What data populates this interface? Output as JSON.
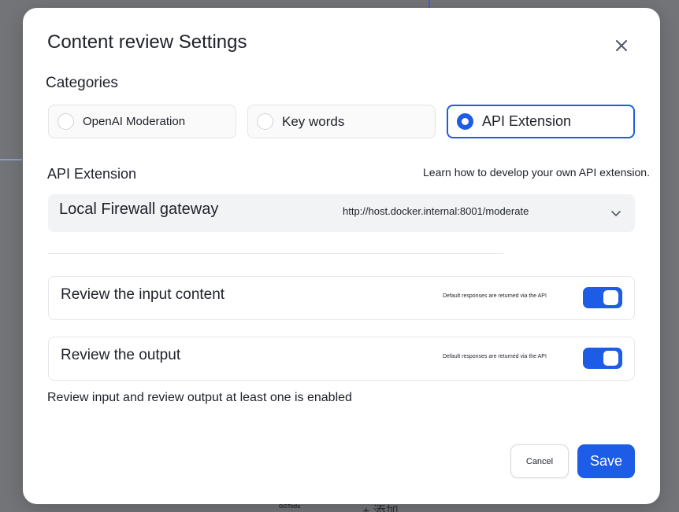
{
  "background": {
    "small_text": "GGToda",
    "add_text": "+ 添加"
  },
  "modal": {
    "title": "Content review Settings",
    "categories_label": "Categories",
    "categories": [
      {
        "label": "OpenAI Moderation",
        "selected": false
      },
      {
        "label": "Key words",
        "selected": false
      },
      {
        "label": "API Extension",
        "selected": true
      }
    ],
    "api_extension": {
      "label": "API Extension",
      "learn_link": "Learn how to develop your own API extension.",
      "selected_name": "Local Firewall gateway",
      "selected_url": "http://host.docker.internal:8001/moderate"
    },
    "review_input": {
      "title": "Review the input content",
      "description": "Default responses are returned via the API",
      "enabled": true
    },
    "review_output": {
      "title": "Review the output",
      "description": "Default responses are returned via the API",
      "enabled": true
    },
    "hint": "Review input and review output at least one is enabled",
    "cancel_label": "Cancel",
    "save_label": "Save"
  },
  "colors": {
    "accent": "#1d5ce6",
    "overlay": "#737478",
    "muted_bg": "#f2f3f5"
  }
}
